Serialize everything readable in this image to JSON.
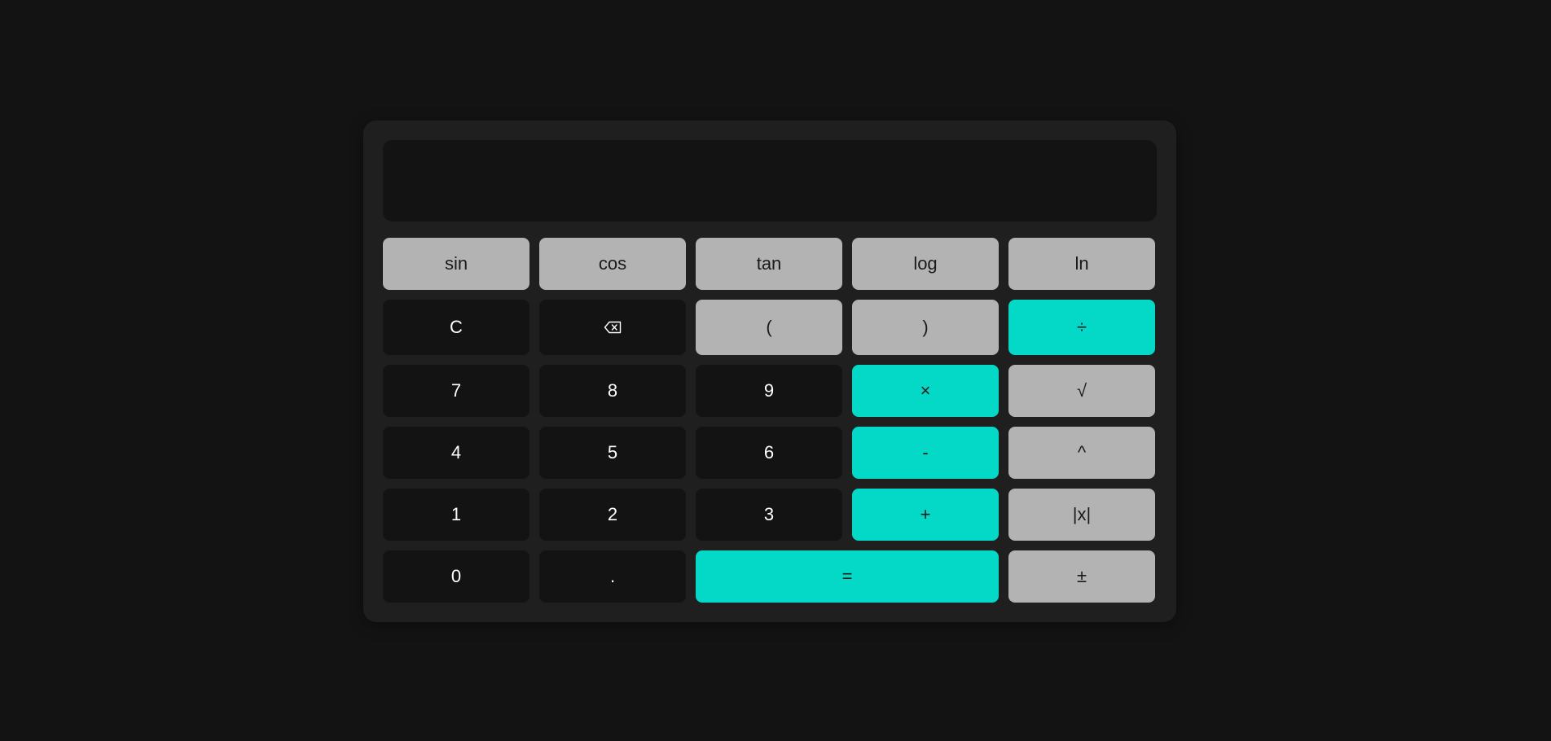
{
  "display": {
    "value": ""
  },
  "rows": {
    "r1": [
      "sin",
      "cos",
      "tan",
      "log",
      "ln"
    ],
    "r2": [
      "C",
      "",
      "(",
      ")",
      "÷"
    ],
    "r3": [
      "7",
      "8",
      "9",
      "×",
      "√"
    ],
    "r4": [
      "4",
      "5",
      "6",
      "-",
      "^"
    ],
    "r5": [
      "1",
      "2",
      "3",
      "+",
      "|x|"
    ],
    "r6": [
      "0",
      ".",
      "=",
      "±"
    ]
  },
  "icons": {
    "backspace": "backspace-icon"
  },
  "colors": {
    "page_bg": "#131313",
    "panel_bg": "#1f1f1f",
    "function_btn": "#b3b3b3",
    "digit_btn": "#131313",
    "accent_btn": "#04d9c7"
  }
}
